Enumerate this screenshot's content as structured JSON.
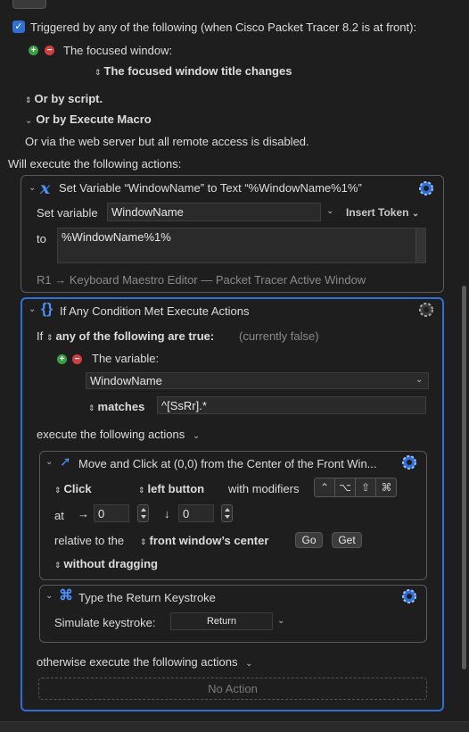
{
  "trigger": {
    "label": "Triggered by any of the following (when Cisco Packet Tracer 8.2 is at front):",
    "focused_window_label": "The focused window:",
    "focused_window_option": "The focused window title changes",
    "or_by_script": "Or by script.",
    "or_by_execute_macro": "Or by Execute Macro",
    "web_server_note": "Or via the web server but all remote access is disabled.",
    "will_execute": "Will execute the following actions:"
  },
  "action1": {
    "title": "Set Variable “WindowName” to Text “%WindowName%1%”",
    "set_variable_label": "Set variable",
    "variable_name": "WindowName",
    "insert_token": "Insert Token",
    "to_label": "to",
    "to_value": "%WindowName%1%",
    "footer": "R1 → Keyboard Maestro Editor — Packet Tracer Active Window"
  },
  "action2": {
    "title": "If Any Condition Met Execute Actions",
    "if_label": "If",
    "condition_mode": "any of the following are true:",
    "condition_status": "(currently false)",
    "variable_label": "The variable:",
    "variable_name": "WindowName",
    "match_mode": "matches",
    "match_value": "^[SsRr].*",
    "execute_label": "execute the following actions",
    "otherwise_label": "otherwise execute the following actions",
    "no_action": "No Action"
  },
  "move_click": {
    "title": "Move and Click at (0,0) from the Center of the Front Win...",
    "click_mode": "Click",
    "button": "left button",
    "modifiers_label": "with modifiers",
    "modifier_keys": [
      "⌃",
      "⌥",
      "⇧",
      "⌘"
    ],
    "at_label": "at",
    "x_value": "0",
    "y_value": "0",
    "relative_label": "relative to the",
    "relative_option": "front window’s center",
    "go_label": "Go",
    "get_label": "Get",
    "drag_option": "without dragging"
  },
  "keystroke": {
    "title": "Type the Return Keystroke",
    "simulate_label": "Simulate keystroke:",
    "key_value": "Return"
  },
  "colors": {
    "background": "#1e1e1e",
    "accent": "#2f6fd6",
    "checkbox": "#2f6fd6"
  }
}
